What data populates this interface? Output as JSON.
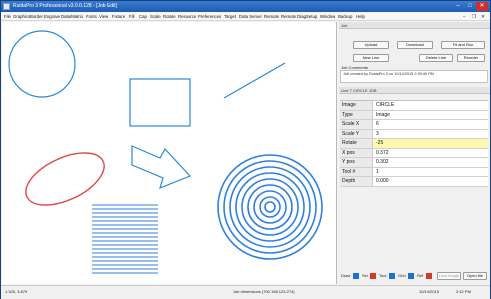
{
  "window": {
    "title": "RuidaPro 3 Professional v3.0.0.128 - [Job Edit]",
    "controls": {
      "minimize": "–",
      "maximize": "□",
      "close": "✕"
    },
    "mdi_controls": {
      "minimize": "–",
      "restore": "❐",
      "close": "✕"
    }
  },
  "menu": [
    "File",
    "Graphics",
    "Border",
    "Engrave",
    "Data/Matrix",
    "Fonts",
    "View",
    "Fixture",
    "Fill",
    "Cap",
    "Scale",
    "Rotate",
    "Resource",
    "Preferences",
    "Target",
    "Data Server",
    "Remote",
    "Remote Diag",
    "Setup",
    "Window",
    "Backup",
    "Help"
  ],
  "job_panel": {
    "title": "Job",
    "buttons": {
      "upload": "Upload",
      "download": "Download",
      "fit_and_run": "Fit and Run",
      "new_line": "New Line",
      "delete_line": "Delete Line",
      "reorder": "Reorder"
    },
    "comments_label": "Job Comments",
    "comments": "Job created by RuidaPro 3 on 10/14/2015 2:39:49 PM"
  },
  "line_panel": {
    "title": "Line 7 CIRCLE JOB",
    "properties": [
      {
        "key": "Image",
        "value": "CIRCLE"
      },
      {
        "key": "Type",
        "value": "Image"
      },
      {
        "key": "Scale X",
        "value": "6"
      },
      {
        "key": "Scale Y",
        "value": "3"
      },
      {
        "key": "Rotate",
        "value": "-25"
      },
      {
        "key": "X pos",
        "value": "0.372"
      },
      {
        "key": "Y pos",
        "value": "0.302"
      },
      {
        "key": "Tool #",
        "value": "1"
      },
      {
        "key": "Depth",
        "value": "0.000"
      }
    ]
  },
  "legend": {
    "draw": "Draw",
    "sel": "Sel",
    "tool": "Tool",
    "grid": "Grid",
    "ref": "Ref",
    "lock_image": "Lock image",
    "open_file": "Open file",
    "colors": {
      "draw": "#1e6fd0",
      "sel": "#d33a2a",
      "tool": "#1e6fd0",
      "grid": "#1e6fd0",
      "ref": "#d33a2a"
    }
  },
  "status": {
    "coords": "1.326, 3.679",
    "dims": "Job dimensions (700.198 123.274)",
    "date": "10/14/2015",
    "time": "2:42 PM"
  },
  "colors": {
    "shape_blue": "#2a8ad8",
    "shape_red": "#e04848",
    "line_blue": "#2f7fe0"
  }
}
